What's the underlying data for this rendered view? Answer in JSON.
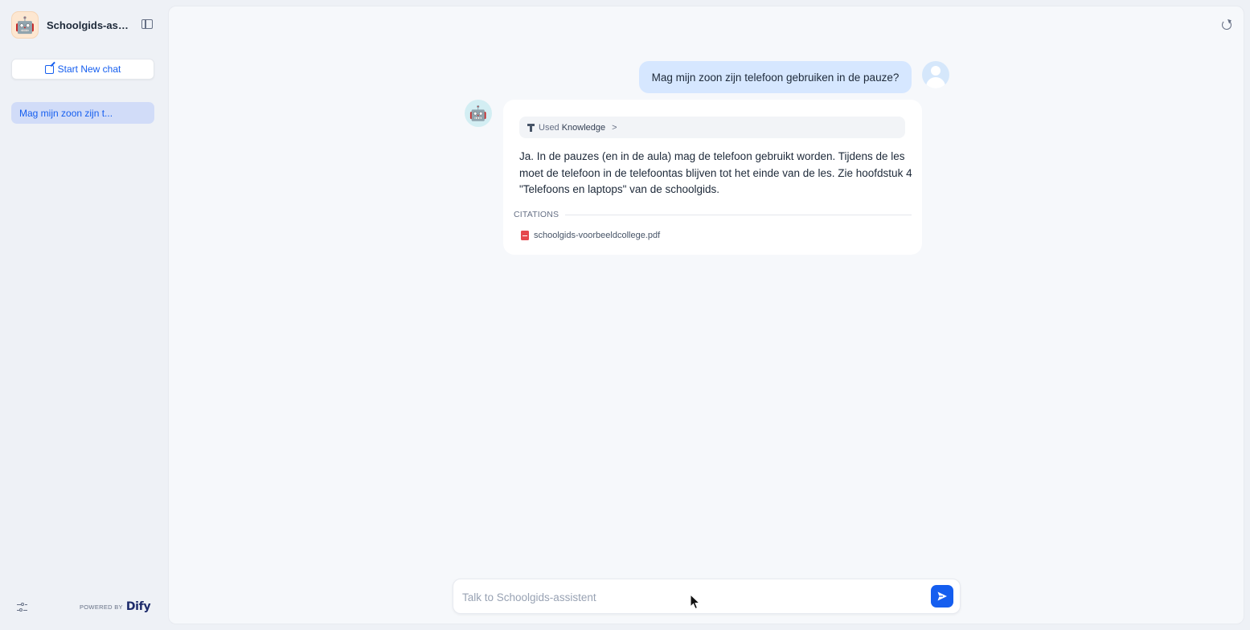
{
  "sidebar": {
    "app_title": "Schoolgids-assi...",
    "app_icon": "robot-emoji-icon",
    "new_chat_label": "Start New chat",
    "conversations": [
      {
        "label": "Mag mijn zoon zijn t..."
      }
    ],
    "powered_by_label": "POWERED BY",
    "brand": "Dify"
  },
  "chat": {
    "user_message": "Mag mijn zoon zijn telefoon gebruiken in de pauze?",
    "knowledge_used_prefix": "Used",
    "knowledge_used_label": "Knowledge",
    "answer": "Ja. In de pauzes (en in de aula) mag de telefoon gebruikt worden. Tijdens de les moet de telefoon in de telefoontas blijven tot het einde van de les. Zie hoofdstuk 4 \"Telefoons en laptops\" van de schoolgids.",
    "citations_label": "CITATIONS",
    "citations": [
      {
        "name": "schoolgids-voorbeeldcollege.pdf"
      }
    ]
  },
  "input": {
    "placeholder": "Talk to Schoolgids-assistent",
    "value": ""
  },
  "colors": {
    "accent": "#155eef",
    "user_bubble": "#d6e7ff",
    "active_conversation": "#d1dcf8"
  }
}
